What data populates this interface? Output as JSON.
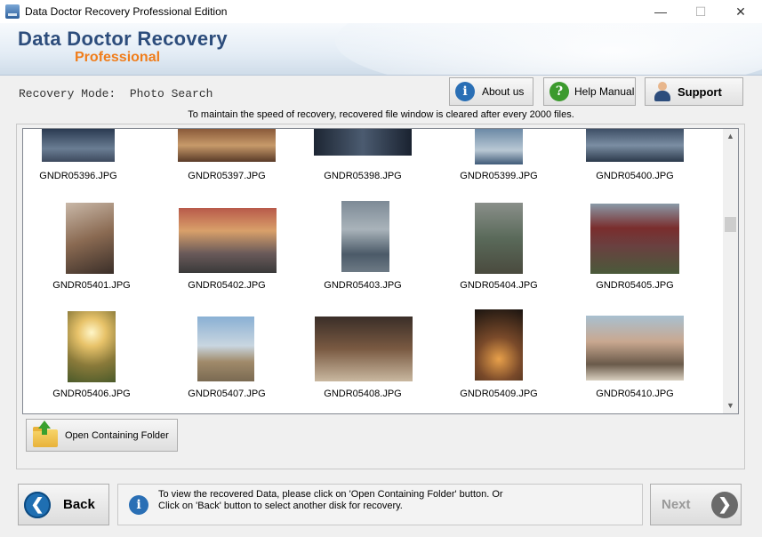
{
  "window": {
    "title": "Data Doctor Recovery Professional Edition",
    "controls": [
      "—",
      "☐",
      "✕"
    ]
  },
  "brand": {
    "name": "Data Doctor Recovery",
    "edition": "Professional"
  },
  "toolbar": {
    "mode_label": "Recovery Mode:  Photo Search",
    "about": "About us",
    "help": "Help Manual",
    "support": "Support"
  },
  "notice": "To maintain the speed of recovery, recovered file window is cleared after every 2000 files.",
  "files": [
    "GNDR05396.JPG",
    "GNDR05397.JPG",
    "GNDR05398.JPG",
    "GNDR05399.JPG",
    "GNDR05400.JPG",
    "GNDR05401.JPG",
    "GNDR05402.JPG",
    "GNDR05403.JPG",
    "GNDR05404.JPG",
    "GNDR05405.JPG",
    "GNDR05406.JPG",
    "GNDR05407.JPG",
    "GNDR05408.JPG",
    "GNDR05409.JPG",
    "GNDR05410.JPG"
  ],
  "open_folder": "Open Containing Folder",
  "back": "Back",
  "next": "Next",
  "info": {
    "line1": "To view the recovered Data, please click on 'Open Containing Folder' button. Or",
    "line2": "Click on 'Back' button to select another disk for recovery."
  },
  "colors": {
    "brand_blue": "#2d4d7c",
    "brand_orange": "#f07d1b",
    "back_circle": "#1f6fb2",
    "next_disabled": "#9a9a9a"
  }
}
